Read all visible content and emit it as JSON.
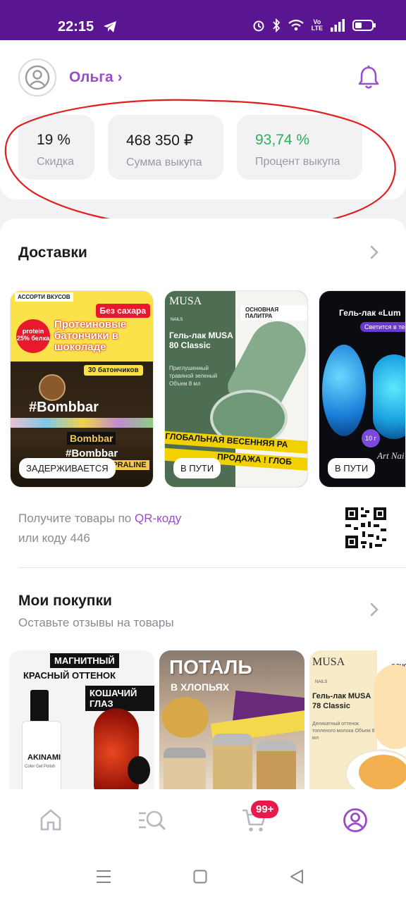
{
  "status_bar": {
    "time": "22:15",
    "volte": "Vo\nLTE"
  },
  "profile": {
    "name": "Ольга ›"
  },
  "stats": [
    {
      "value": "19 %",
      "label": "Скидка"
    },
    {
      "value": "468 350 ₽",
      "label": "Сумма выкупа"
    },
    {
      "value": "93,74 %",
      "label": "Процент выкупа"
    }
  ],
  "deliveries": {
    "title": "Доставки",
    "items": [
      {
        "status": "ЗАДЕРЖИВАЕТСЯ",
        "banner": "АССОРТИ ВКУСОВ",
        "badge": "Без сахара",
        "headline": "Протеиновые батончики в шоколаде",
        "promo": "protein 25% белка",
        "count": "30 батончиков",
        "brand": "#Bombbar",
        "flavor": "HAZELNUT PRALINE"
      },
      {
        "status": "В ПУТИ",
        "brand": "MUSA",
        "brand_sub": "NAILS",
        "tag": "ОСНОВНАЯ ПАЛИТРА",
        "title": "Гель-лак MUSA 80 Classic",
        "desc": "Приглушенный травяной зеленый Объем 8 мл",
        "sale1": "ГЛОБАЛЬНАЯ ВЕСЕННЯЯ РА",
        "sale2": "ПРОДАЖА ! ГЛОБ"
      },
      {
        "status": "В ПУТИ",
        "title": "Гель-лак «Lum",
        "sub": "Светится в тем",
        "weight": "10 г",
        "brand": "Art Nai"
      }
    ],
    "qr_text_1": "Получите товары по ",
    "qr_link": "QR-коду",
    "qr_text_2": "или коду 446"
  },
  "purchases": {
    "title": "Мои покупки",
    "subtitle": "Оставьте отзывы на товары",
    "items": [
      {
        "line1": "МАГНИТНЫЙ",
        "line2": "КРАСНЫЙ ОТТЕНОК",
        "line3": "КОШАЧИЙ ГЛАЗ",
        "brand": "AKINAMI",
        "brand_sub": "Color Gel Polish"
      },
      {
        "line1": "ПОТАЛЬ",
        "line2": "В ХЛОПЬЯХ"
      },
      {
        "brand": "MUSA",
        "brand_sub": "NAILS",
        "tag": "ОСНО",
        "title": "Гель-лак MUSA 78 Classic",
        "desc": "Деликатный оттенок топленого молока Объем 8 мл"
      }
    ]
  },
  "bottom_nav": {
    "cart_badge": "99+"
  },
  "colors": {
    "accent": "#9a4dc8",
    "status_bar": "#5a1590",
    "green": "#2fb05a",
    "badge": "#e8194d"
  },
  "icons": [
    "telegram-icon",
    "alarm-icon",
    "bluetooth-icon",
    "wifi-icon",
    "signal-icon",
    "battery-icon",
    "avatar-icon",
    "bell-icon",
    "chevron-right-icon",
    "qr-code-icon",
    "home-icon",
    "catalog-search-icon",
    "cart-icon",
    "profile-icon",
    "menu-icon",
    "square-icon",
    "back-icon"
  ]
}
